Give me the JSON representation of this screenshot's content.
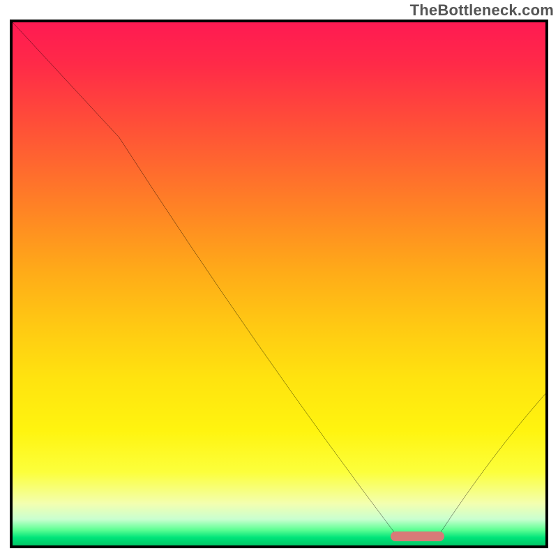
{
  "watermark": "TheBottleneck.com",
  "chart_data": {
    "type": "line",
    "title": "",
    "xlabel": "",
    "ylabel": "",
    "xlim": [
      0,
      100
    ],
    "ylim": [
      0,
      100
    ],
    "grid": false,
    "legend": false,
    "series": [
      {
        "name": "bottleneck-curve",
        "x": [
          0,
          20,
          72,
          80,
          100
        ],
        "values": [
          100,
          78,
          2,
          2,
          29
        ]
      }
    ],
    "annotations": [
      {
        "name": "optimal-range-marker",
        "x_start": 71,
        "x_end": 81,
        "y": 1.8
      }
    ],
    "background": "vertical-gradient-red-to-green"
  },
  "colors": {
    "curve": "#000000",
    "marker": "#d87a78",
    "frame": "#000000"
  }
}
